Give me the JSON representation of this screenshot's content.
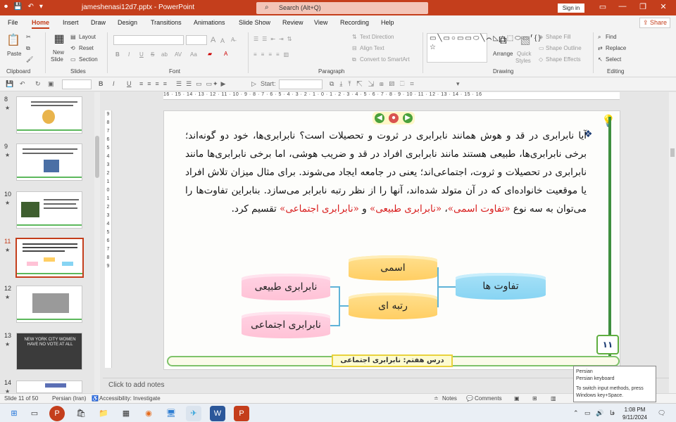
{
  "window": {
    "title": "jameshenasi12d7.pptx  -  PowerPoint",
    "search_placeholder": "Search (Alt+Q)",
    "sign_in": "Sign in",
    "min": "—",
    "restore": "❐",
    "close": "✕"
  },
  "tabs": [
    "File",
    "Home",
    "Insert",
    "Draw",
    "Design",
    "Transitions",
    "Animations",
    "Slide Show",
    "Review",
    "View",
    "Recording",
    "Help"
  ],
  "active_tab": "Home",
  "share_label": "Share",
  "ribbon": {
    "clipboard": {
      "paste": "Paste",
      "label": "Clipboard"
    },
    "slides": {
      "new_slide": "New",
      "new_slide2": "Slide",
      "layout": "Layout",
      "reset": "Reset",
      "section": "Section",
      "label": "Slides"
    },
    "font": {
      "label": "Font",
      "bold": "B",
      "italic": "I",
      "underline": "U",
      "strike": "S",
      "shadow": "ab",
      "spacing": "AV",
      "case": "Aa",
      "grow": "A",
      "shrink": "A"
    },
    "paragraph": {
      "label": "Paragraph",
      "text_direction": "Text Direction",
      "align_text": "Align Text",
      "convert_smartart": "Convert to SmartArt"
    },
    "drawing": {
      "label": "Drawing",
      "arrange": "Arrange",
      "quick_styles": "Quick",
      "quick_styles2": "Styles",
      "shape_fill": "Shape Fill",
      "shape_outline": "Shape Outline",
      "shape_effects": "Shape Effects",
      "shapes_glyphs": "▭╲▭○▭▭⬭╲⌒◺△⬚⬭▭⸢{}☆"
    },
    "editing": {
      "label": "Editing",
      "find": "Find",
      "replace": "Replace",
      "select": "Select"
    }
  },
  "toolbar2": {
    "start": "Start:"
  },
  "thumbnails": [
    {
      "num": "8",
      "star": "★"
    },
    {
      "num": "9",
      "star": "★"
    },
    {
      "num": "10",
      "star": "★"
    },
    {
      "num": "11",
      "star": "★",
      "selected": true
    },
    {
      "num": "12",
      "star": "★"
    },
    {
      "num": "13",
      "star": "★",
      "caption": "NEW YORK CITY WOMEN HAVE NO VOTE AT ALL"
    },
    {
      "num": "14",
      "star": "★"
    }
  ],
  "hruler": "16 · 15 · 14 · 13 · 12 · 11 · 10 · 9 · 8 · 7 · 6 · 5 · 4 · 3 · 2 · 1 · 0 · 1 · 2 · 3 · 4 · 5 · 6 · 7 · 8 · 9 · 10 · 11 · 12 · 13 · 14 · 15 · 16",
  "vruler": [
    "9",
    "8",
    "7",
    "6",
    "5",
    "4",
    "3",
    "2",
    "1",
    "0",
    "1",
    "2",
    "3",
    "4",
    "5",
    "6",
    "7",
    "8",
    "9"
  ],
  "slide": {
    "paragraph_parts": {
      "p1": "آیا نابرابری در قد و هوش همانند نابرابری در ثروت و تحصیلات است؟ نابرابری‌ها، خود دو گونه‌اند؛ برخی نابرابری‌ها، طبیعی هستند مانند نابرابری افراد در قد و ضریب هوشی، اما برخی نابرابری‌ها مانند نابرابری در تحصیلات و ثروت، اجتماعی‌اند؛ یعنی در جامعه ایجاد می‌شوند. برای مثال میزان تلاش افراد یا موقعیت خانواده‌ای که در آن متولد شده‌اند، آنها را از نظر رتبه نابرابر می‌سازد. بنابراین تفاوت‌ها را می‌توان به سه نوع ",
      "q1": "«تفاوت اسمی»",
      "sep1": "، ",
      "q2": "«نابرابری طبیعی»",
      "sep2": " و ",
      "q3": "«نابرابری اجتماعی»",
      "p2": " تقسیم کرد."
    },
    "bullet": "❖",
    "diagram": {
      "root": "تفاوت ها",
      "mid_top": "اسمی",
      "mid_bottom": "رتبه ای",
      "leaf_top": "نابرابری طبیعی",
      "leaf_bottom": "نابرابری اجتماعی"
    },
    "footer_label": "درس هفتم: نابرابری اجتماعی",
    "page_number": "۱۱",
    "nav_prev": "◀",
    "nav_home": "●",
    "nav_next": "▶",
    "bulb": "💡"
  },
  "notes_placeholder": "Click to add notes",
  "status": {
    "slide_of": "Slide 11 of 50",
    "language": "Persian (Iran)",
    "accessibility": "Accessibility: Investigate",
    "notes": "Notes",
    "comments": "Comments"
  },
  "tooltip": {
    "line1": "Persian",
    "line2": "Persian keyboard",
    "line3": "To switch input methods, press Windows key+Space."
  },
  "taskbar": {
    "time": "1:08 PM",
    "date": "9/11/2024",
    "lang": "فا"
  }
}
